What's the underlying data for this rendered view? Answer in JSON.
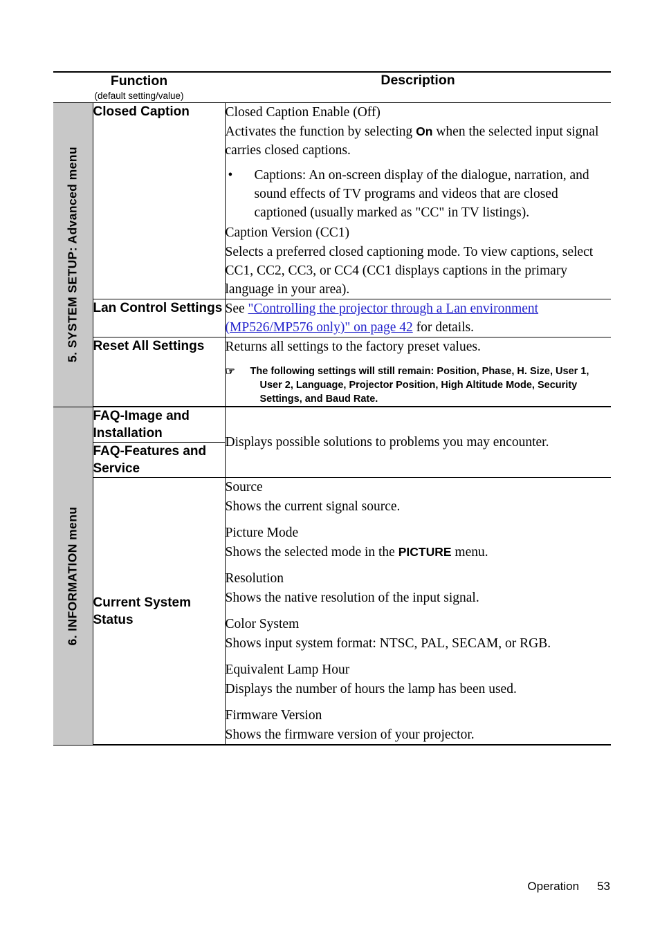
{
  "header": {
    "function_title": "Function",
    "function_subtitle": "(default setting/value)",
    "description_title": "Description"
  },
  "sections": [
    {
      "band_label": "5. SYSTEM SETUP: Advanced menu",
      "rows": [
        {
          "function": "Closed Caption",
          "blocks": [
            {
              "type": "heading",
              "text": "Closed Caption Enable (Off)"
            },
            {
              "type": "paragraph_on",
              "pre": "Activates the function by selecting ",
              "ui": "On",
              "post": " when the selected input signal carries closed captions."
            },
            {
              "type": "bullet",
              "text": "Captions: An on-screen display of the dialogue, narration, and sound effects of TV programs and videos that are closed captioned (usually marked as \"CC\" in TV listings)."
            },
            {
              "type": "heading",
              "text": "Caption Version (CC1)"
            },
            {
              "type": "paragraph",
              "text": "Selects a preferred closed captioning mode. To view captions, select CC1, CC2, CC3, or CC4 (CC1 displays captions in the primary language in your area)."
            }
          ]
        },
        {
          "function": "Lan Control Settings",
          "link_pre": "See ",
          "link_text": "\"Controlling the projector through a Lan environment (MP526/MP576 only)\" on page 42",
          "link_post": " for details."
        },
        {
          "function": "Reset All Settings",
          "paragraph": "Returns all settings to the factory preset values.",
          "note": "The following settings will still remain: Position, Phase, H. Size, User 1, User 2, Language, Projector Position, High Altitude Mode, Security Settings, and Baud Rate."
        }
      ]
    },
    {
      "band_label": "6. INFORMATION menu",
      "rows": [
        {
          "function": "FAQ-Image and Installation"
        },
        {
          "function": "FAQ-Features and Service"
        },
        {
          "shared_description": "Displays possible solutions to problems you may encounter."
        },
        {
          "function": "Current System Status",
          "items": [
            {
              "heading": "Source",
              "text": "Shows the current signal source."
            },
            {
              "heading": "Picture Mode",
              "pre": "Shows the selected mode in the ",
              "ui": "PICTURE",
              "post": " menu."
            },
            {
              "heading": "Resolution",
              "text": "Shows the native resolution of the input signal."
            },
            {
              "heading": "Color System",
              "text": "Shows input system format: NTSC, PAL, SECAM, or RGB."
            },
            {
              "heading": "Equivalent Lamp Hour",
              "text": "Displays the number of hours the lamp has been used."
            },
            {
              "heading": "Firmware Version",
              "text": "Shows the firmware version of your projector."
            }
          ]
        }
      ]
    }
  ],
  "footer": {
    "chapter": "Operation",
    "page_number": "53"
  }
}
